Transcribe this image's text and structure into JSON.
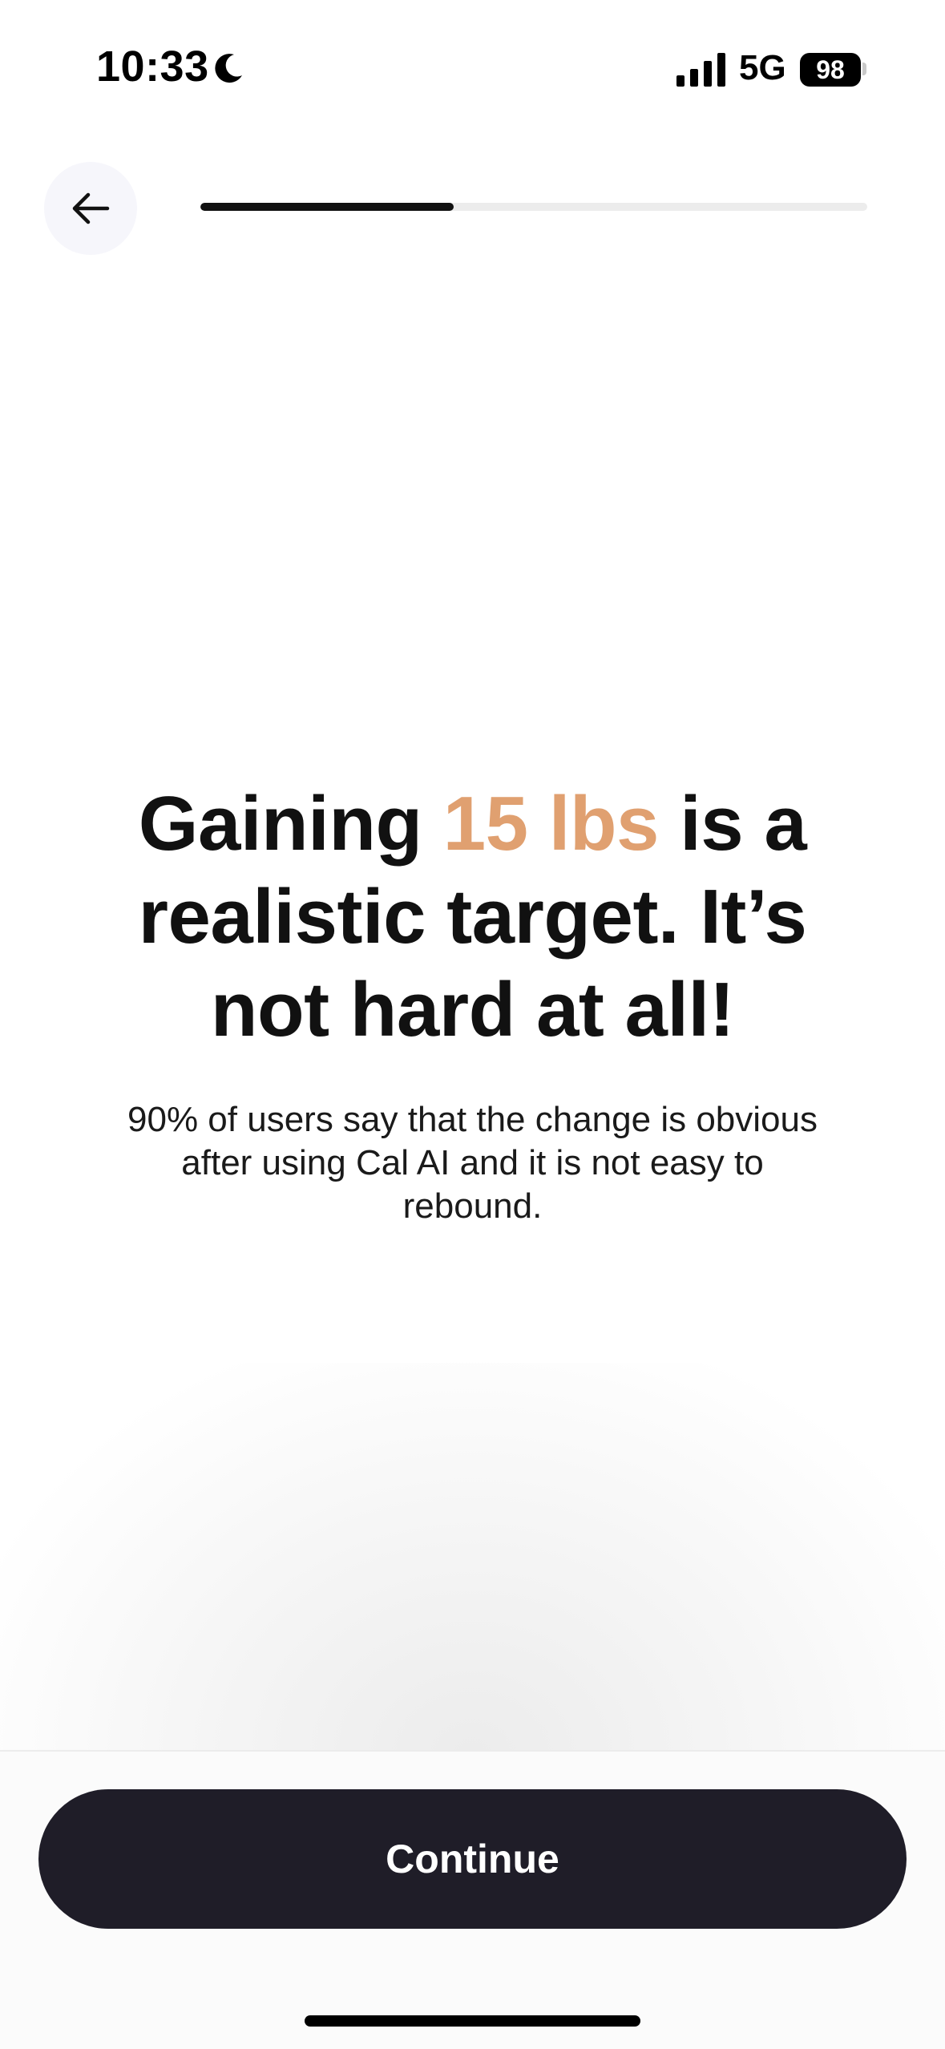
{
  "status_bar": {
    "time": "10:33",
    "network": "5G",
    "battery": "98",
    "icons": [
      "moon-icon",
      "signal-bars-icon",
      "battery-icon"
    ]
  },
  "header": {
    "back_icon": "arrow-left-icon",
    "progress_fraction": 0.38
  },
  "main": {
    "headline_prefix": "Gaining ",
    "headline_highlight": "15 lbs",
    "headline_suffix": " is a realistic target. It’s not hard at all!",
    "subtitle": "90% of users say that the change is obvious after using Cal AI and it is not easy to rebound."
  },
  "footer": {
    "continue_label": "Continue"
  },
  "colors": {
    "highlight": "#e0a070",
    "button_bg": "#1f1d28",
    "progress_fill": "#111111",
    "progress_track": "#ececec"
  }
}
